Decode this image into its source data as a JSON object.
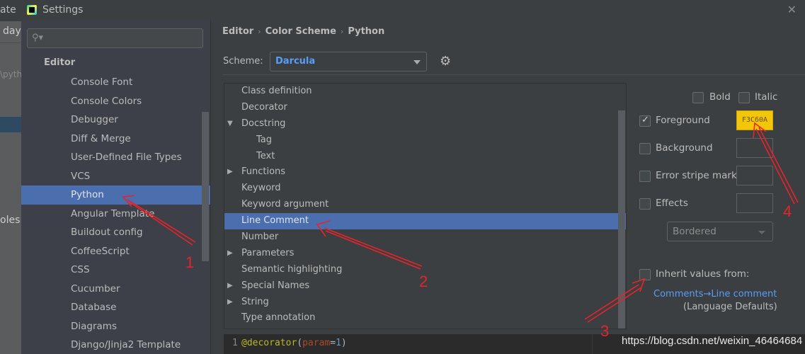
{
  "background_ide": {
    "top_text": "ate",
    "text1": "day",
    "text2": "\\pyth",
    "text3": "oles"
  },
  "window": {
    "title": "Settings",
    "close_icon": "close-icon"
  },
  "sidebar": {
    "search": {
      "value": "",
      "placeholder": ""
    },
    "section": "Editor",
    "items": [
      {
        "label": "Console Font"
      },
      {
        "label": "Console Colors"
      },
      {
        "label": "Debugger"
      },
      {
        "label": "Diff & Merge"
      },
      {
        "label": "User-Defined File Types"
      },
      {
        "label": "VCS"
      },
      {
        "label": "Python",
        "selected": true
      },
      {
        "label": "Angular Template"
      },
      {
        "label": "Buildout config"
      },
      {
        "label": "CoffeeScript"
      },
      {
        "label": "CSS"
      },
      {
        "label": "Cucumber"
      },
      {
        "label": "Database"
      },
      {
        "label": "Diagrams"
      },
      {
        "label": "Django/Jinja2 Template"
      }
    ]
  },
  "breadcrumb": [
    "Editor",
    "Color Scheme",
    "Python"
  ],
  "breadcrumb_sep": "›",
  "scheme": {
    "label": "Scheme:",
    "value": "Darcula",
    "value_color": "#589df6"
  },
  "attributes": {
    "items": [
      {
        "label": "Class definition",
        "toggle": ""
      },
      {
        "label": "Decorator",
        "toggle": ""
      },
      {
        "label": "Docstring",
        "toggle": "▼"
      },
      {
        "label": "Tag",
        "toggle": "",
        "child": true
      },
      {
        "label": "Text",
        "toggle": "",
        "child": true
      },
      {
        "label": "Functions",
        "toggle": "▶"
      },
      {
        "label": "Keyword",
        "toggle": ""
      },
      {
        "label": "Keyword argument",
        "toggle": ""
      },
      {
        "label": "Line Comment",
        "toggle": "",
        "selected": true
      },
      {
        "label": "Number",
        "toggle": ""
      },
      {
        "label": "Parameters",
        "toggle": "▶"
      },
      {
        "label": "Semantic highlighting",
        "toggle": ""
      },
      {
        "label": "Special Names",
        "toggle": "▶"
      },
      {
        "label": "String",
        "toggle": "▶"
      },
      {
        "label": "Type annotation",
        "toggle": ""
      }
    ]
  },
  "options": {
    "bold": {
      "label": "Bold",
      "checked": false
    },
    "italic": {
      "label": "Italic",
      "checked": false
    },
    "foreground": {
      "label": "Foreground",
      "checked": true,
      "color_text": "F3C60A",
      "color": "#f3c60a"
    },
    "background": {
      "label": "Background",
      "checked": false
    },
    "error_stripe": {
      "label": "Error stripe mark",
      "checked": false
    },
    "effects": {
      "label": "Effects",
      "checked": false
    },
    "effect_type": "Bordered",
    "inherit": {
      "label": "Inherit values from:",
      "checked": false
    },
    "inherit_link": "Comments→Line comment",
    "inherit_sub": "(Language Defaults)"
  },
  "preview": {
    "line_number": "1",
    "decorator": "@decorator",
    "open": "(",
    "param": "param",
    "eq": "=",
    "num": "1",
    "close": ")"
  },
  "watermark": "https://blog.csdn.net/weixin_46464684",
  "annotations": {
    "color": "#e5242b",
    "labels": [
      "1",
      "2",
      "3",
      "4"
    ]
  }
}
